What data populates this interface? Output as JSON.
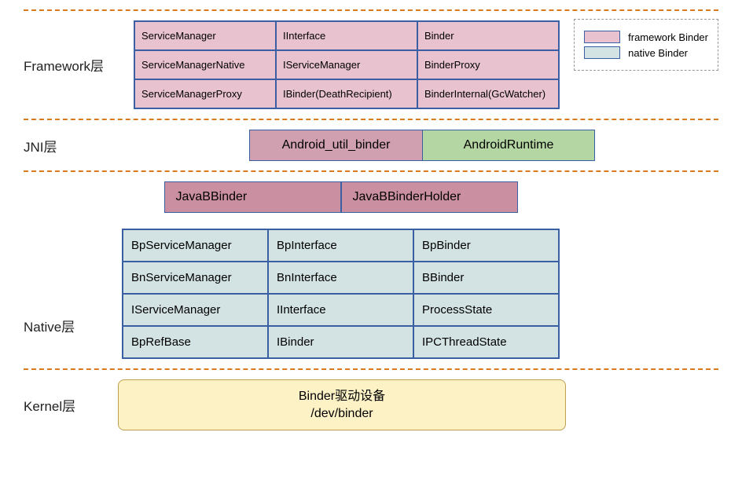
{
  "layers": {
    "framework": {
      "label": "Framework层",
      "cells": [
        "ServiceManager",
        "IInterface",
        "Binder",
        "ServiceManagerNative",
        "IServiceManager",
        "BinderProxy",
        "ServiceManagerProxy",
        "IBinder(DeathRecipient)",
        "BinderInternal(GcWatcher)"
      ]
    },
    "jni": {
      "label": "JNI层",
      "items": [
        "Android_util_binder",
        "AndroidRuntime"
      ]
    },
    "native": {
      "label": "Native层",
      "top": [
        "JavaBBinder",
        "JavaBBinderHolder"
      ],
      "grid": [
        "BpServiceManager",
        "BpInterface",
        "BpBinder",
        "BnServiceManager",
        "BnInterface",
        "BBinder",
        "IServiceManager",
        "IInterface",
        "ProcessState",
        "BpRefBase",
        "IBinder",
        "IPCThreadState"
      ]
    },
    "kernel": {
      "label": "Kernel层",
      "title": "Binder驱动设备",
      "path": "/dev/binder"
    }
  },
  "legend": {
    "pink": "framework Binder",
    "blue": "native Binder"
  },
  "colors": {
    "pink": "#e8c3cf",
    "blue": "#d3e2e2",
    "green": "#b4d6a3",
    "yellow": "#fdf2c6",
    "border": "#3b5fa3",
    "dash": "#d97a1f"
  }
}
